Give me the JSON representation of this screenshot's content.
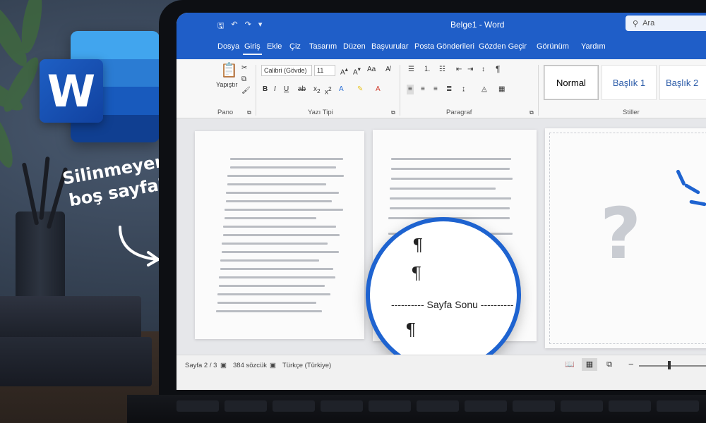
{
  "app": {
    "title": "Belge1 - Word",
    "search_placeholder": "Ara",
    "qat": {
      "save_icon": "save-icon",
      "undo_icon": "undo-icon",
      "redo_icon": "redo-icon"
    }
  },
  "menu": {
    "tabs": [
      {
        "label": "Dosya"
      },
      {
        "label": "Giriş",
        "active": true
      },
      {
        "label": "Ekle"
      },
      {
        "label": "Çiz"
      },
      {
        "label": "Tasarım"
      },
      {
        "label": "Düzen"
      },
      {
        "label": "Başvurular"
      },
      {
        "label": "Posta Gönderileri"
      },
      {
        "label": "Gözden Geçir"
      },
      {
        "label": "Görünüm"
      },
      {
        "label": "Yardım"
      }
    ]
  },
  "ribbon": {
    "clipboard": {
      "paste_label": "Yapıştır",
      "group_label": "Pano"
    },
    "font": {
      "font_name": "Calibri (Gövde)",
      "font_size": "11",
      "group_label": "Yazı Tipi"
    },
    "paragraph": {
      "group_label": "Paragraf"
    },
    "styles": {
      "group_label": "Stiller",
      "items": [
        "Normal",
        "Başlık 1",
        "Başlık 2"
      ]
    }
  },
  "document": {
    "page_break_text": "---------- Sayfa Sonu ----------",
    "pilcrow": "¶",
    "question": "?"
  },
  "annotation": {
    "line1": "Silinmeyen",
    "line2": "boş sayfa?"
  },
  "logo": {
    "letter": "W"
  },
  "status": {
    "page": "Sayfa 2 / 3",
    "words": "384 sözcük",
    "language": "Türkçe (Türkiye)",
    "zoom_minus": "−",
    "zoom_plus": "+"
  },
  "colors": {
    "accent": "#1f5ec8",
    "highlight_ring": "#1e63d0"
  }
}
